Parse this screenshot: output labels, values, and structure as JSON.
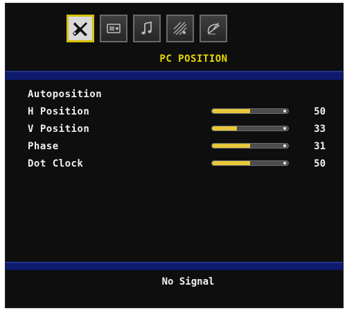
{
  "menu": {
    "title": "PC POSITION",
    "tabs": [
      {
        "icon": "wrench-scissor-icon",
        "active": true
      },
      {
        "icon": "picture-monitor-icon",
        "active": false
      },
      {
        "icon": "music-note-icon",
        "active": false
      },
      {
        "icon": "features-icon",
        "active": false
      },
      {
        "icon": "install-satellite-icon",
        "active": false
      }
    ],
    "items": [
      {
        "label": "Autoposition"
      },
      {
        "label": "H Position",
        "value": "50",
        "level": 0.5
      },
      {
        "label": "V Position",
        "value": "33",
        "level": 0.33
      },
      {
        "label": "Phase",
        "value": "31",
        "level": 0.5
      },
      {
        "label": "Dot Clock",
        "value": "50",
        "level": 0.5
      }
    ]
  },
  "status": {
    "message": "No Signal"
  },
  "colors": {
    "accent": "#e8d800",
    "band": "#0d1a6e",
    "slider_fill": "#e6c83a",
    "text": "#f0f0f0",
    "background": "#0e0e0e"
  }
}
